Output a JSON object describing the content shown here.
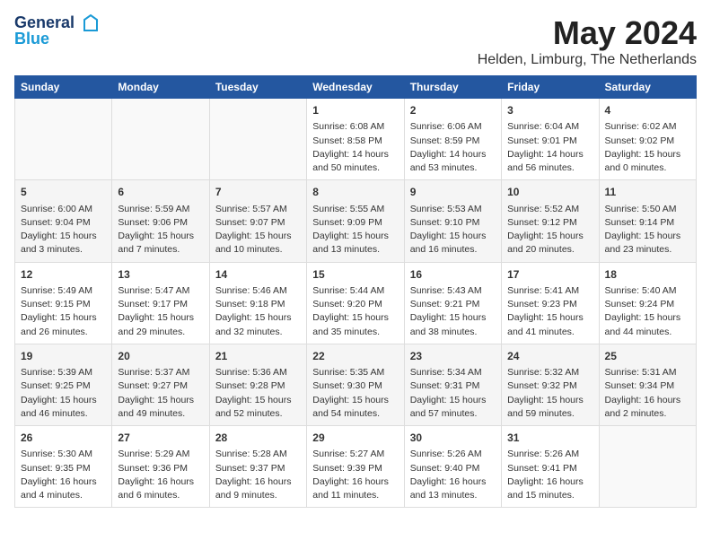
{
  "header": {
    "logo_line1": "General",
    "logo_line2": "Blue",
    "month": "May 2024",
    "location": "Helden, Limburg, The Netherlands"
  },
  "days_of_week": [
    "Sunday",
    "Monday",
    "Tuesday",
    "Wednesday",
    "Thursday",
    "Friday",
    "Saturday"
  ],
  "weeks": [
    [
      {
        "day": "",
        "info": ""
      },
      {
        "day": "",
        "info": ""
      },
      {
        "day": "",
        "info": ""
      },
      {
        "day": "1",
        "info": "Sunrise: 6:08 AM\nSunset: 8:58 PM\nDaylight: 14 hours\nand 50 minutes."
      },
      {
        "day": "2",
        "info": "Sunrise: 6:06 AM\nSunset: 8:59 PM\nDaylight: 14 hours\nand 53 minutes."
      },
      {
        "day": "3",
        "info": "Sunrise: 6:04 AM\nSunset: 9:01 PM\nDaylight: 14 hours\nand 56 minutes."
      },
      {
        "day": "4",
        "info": "Sunrise: 6:02 AM\nSunset: 9:02 PM\nDaylight: 15 hours\nand 0 minutes."
      }
    ],
    [
      {
        "day": "5",
        "info": "Sunrise: 6:00 AM\nSunset: 9:04 PM\nDaylight: 15 hours\nand 3 minutes."
      },
      {
        "day": "6",
        "info": "Sunrise: 5:59 AM\nSunset: 9:06 PM\nDaylight: 15 hours\nand 7 minutes."
      },
      {
        "day": "7",
        "info": "Sunrise: 5:57 AM\nSunset: 9:07 PM\nDaylight: 15 hours\nand 10 minutes."
      },
      {
        "day": "8",
        "info": "Sunrise: 5:55 AM\nSunset: 9:09 PM\nDaylight: 15 hours\nand 13 minutes."
      },
      {
        "day": "9",
        "info": "Sunrise: 5:53 AM\nSunset: 9:10 PM\nDaylight: 15 hours\nand 16 minutes."
      },
      {
        "day": "10",
        "info": "Sunrise: 5:52 AM\nSunset: 9:12 PM\nDaylight: 15 hours\nand 20 minutes."
      },
      {
        "day": "11",
        "info": "Sunrise: 5:50 AM\nSunset: 9:14 PM\nDaylight: 15 hours\nand 23 minutes."
      }
    ],
    [
      {
        "day": "12",
        "info": "Sunrise: 5:49 AM\nSunset: 9:15 PM\nDaylight: 15 hours\nand 26 minutes."
      },
      {
        "day": "13",
        "info": "Sunrise: 5:47 AM\nSunset: 9:17 PM\nDaylight: 15 hours\nand 29 minutes."
      },
      {
        "day": "14",
        "info": "Sunrise: 5:46 AM\nSunset: 9:18 PM\nDaylight: 15 hours\nand 32 minutes."
      },
      {
        "day": "15",
        "info": "Sunrise: 5:44 AM\nSunset: 9:20 PM\nDaylight: 15 hours\nand 35 minutes."
      },
      {
        "day": "16",
        "info": "Sunrise: 5:43 AM\nSunset: 9:21 PM\nDaylight: 15 hours\nand 38 minutes."
      },
      {
        "day": "17",
        "info": "Sunrise: 5:41 AM\nSunset: 9:23 PM\nDaylight: 15 hours\nand 41 minutes."
      },
      {
        "day": "18",
        "info": "Sunrise: 5:40 AM\nSunset: 9:24 PM\nDaylight: 15 hours\nand 44 minutes."
      }
    ],
    [
      {
        "day": "19",
        "info": "Sunrise: 5:39 AM\nSunset: 9:25 PM\nDaylight: 15 hours\nand 46 minutes."
      },
      {
        "day": "20",
        "info": "Sunrise: 5:37 AM\nSunset: 9:27 PM\nDaylight: 15 hours\nand 49 minutes."
      },
      {
        "day": "21",
        "info": "Sunrise: 5:36 AM\nSunset: 9:28 PM\nDaylight: 15 hours\nand 52 minutes."
      },
      {
        "day": "22",
        "info": "Sunrise: 5:35 AM\nSunset: 9:30 PM\nDaylight: 15 hours\nand 54 minutes."
      },
      {
        "day": "23",
        "info": "Sunrise: 5:34 AM\nSunset: 9:31 PM\nDaylight: 15 hours\nand 57 minutes."
      },
      {
        "day": "24",
        "info": "Sunrise: 5:32 AM\nSunset: 9:32 PM\nDaylight: 15 hours\nand 59 minutes."
      },
      {
        "day": "25",
        "info": "Sunrise: 5:31 AM\nSunset: 9:34 PM\nDaylight: 16 hours\nand 2 minutes."
      }
    ],
    [
      {
        "day": "26",
        "info": "Sunrise: 5:30 AM\nSunset: 9:35 PM\nDaylight: 16 hours\nand 4 minutes."
      },
      {
        "day": "27",
        "info": "Sunrise: 5:29 AM\nSunset: 9:36 PM\nDaylight: 16 hours\nand 6 minutes."
      },
      {
        "day": "28",
        "info": "Sunrise: 5:28 AM\nSunset: 9:37 PM\nDaylight: 16 hours\nand 9 minutes."
      },
      {
        "day": "29",
        "info": "Sunrise: 5:27 AM\nSunset: 9:39 PM\nDaylight: 16 hours\nand 11 minutes."
      },
      {
        "day": "30",
        "info": "Sunrise: 5:26 AM\nSunset: 9:40 PM\nDaylight: 16 hours\nand 13 minutes."
      },
      {
        "day": "31",
        "info": "Sunrise: 5:26 AM\nSunset: 9:41 PM\nDaylight: 16 hours\nand 15 minutes."
      },
      {
        "day": "",
        "info": ""
      }
    ]
  ]
}
